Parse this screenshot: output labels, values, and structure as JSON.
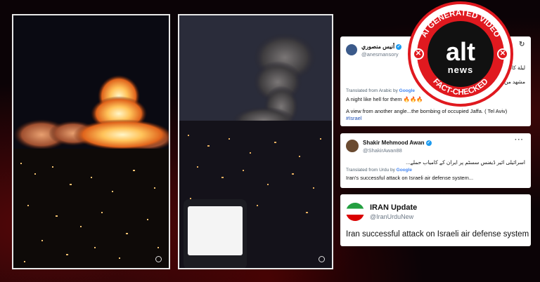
{
  "tweet1": {
    "name": "أنيس منصوري",
    "handle": "@anesmansory",
    "arabic_line1": "ليلة كالجحيم",
    "arabic_line2": "مشهد من زاوية",
    "translated_prefix": "Translated from Arabic by",
    "google": "Google",
    "line1": "A night like hell for them 🔥🔥🔥",
    "line2": "A view from another angle...the bombing of occupied Jaffa. ( Tel Aviv)",
    "hashtag": "#Israel"
  },
  "tweet2": {
    "name": "Shakir Mehmood Awan",
    "handle": "@ShakirAwan88",
    "urdu": "اسرائیلی ائیر ڈیفنس سسٹم پر ایران کے کامیاب حملے...",
    "translated_prefix": "Translated from Urdu by",
    "google": "Google",
    "line1": "Iran's successful attack on Israeli air defense system..."
  },
  "tweet3": {
    "name": "IRAN Update",
    "handle": "@IranUrduNew",
    "line1": "Iran successful attack on Israeli air defense system"
  },
  "badge": {
    "top_text": "AI GENERATED VIDEO",
    "logo": "alt",
    "logo_sub": "news",
    "bottom_text": "FACT-CHECKED"
  },
  "colors": {
    "badge_red": "#e0191f",
    "verified_blue": "#1d9bf0"
  }
}
